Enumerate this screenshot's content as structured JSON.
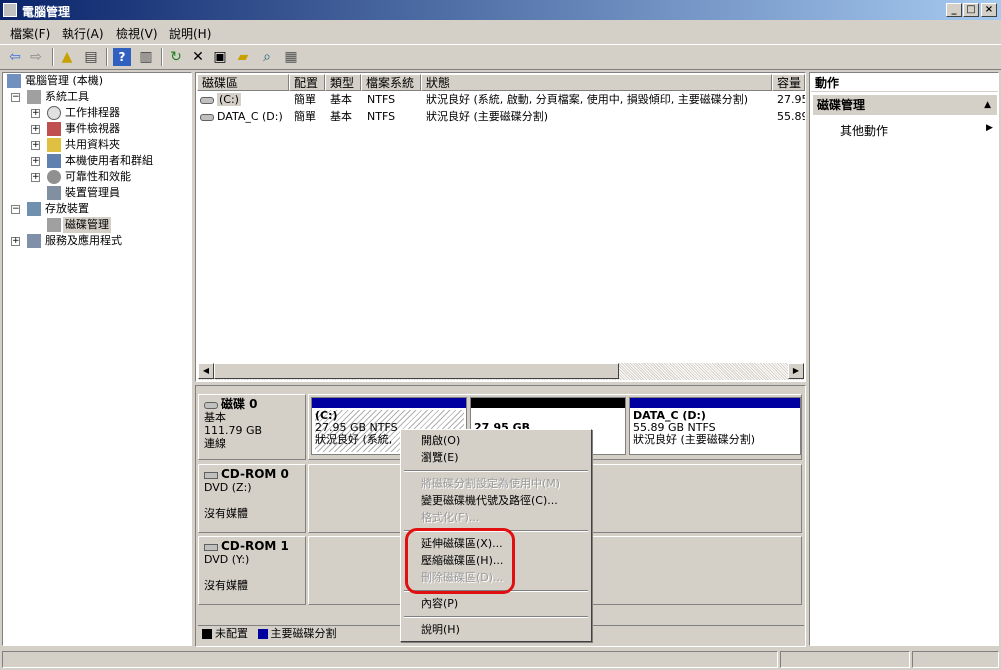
{
  "window": {
    "title": "電腦管理"
  },
  "menu": [
    "檔案(F)",
    "執行(A)",
    "檢視(V)",
    "說明(H)"
  ],
  "tree": {
    "root": "電腦管理 (本機)",
    "system_tools": "系統工具",
    "task_scheduler": "工作排程器",
    "event_viewer": "事件檢視器",
    "shared_folders": "共用資料夾",
    "local_users": "本機使用者和群組",
    "reliability": "可靠性和效能",
    "device_manager": "裝置管理員",
    "storage": "存放裝置",
    "disk_management": "磁碟管理",
    "services_apps": "服務及應用程式"
  },
  "volume_list": {
    "headers": [
      "磁碟區",
      "配置",
      "類型",
      "檔案系統",
      "狀態",
      "容量"
    ],
    "rows": [
      [
        "(C:)",
        "簡單",
        "基本",
        "NTFS",
        "狀況良好 (系統, 啟動, 分頁檔案, 使用中, 損毀傾印, 主要磁碟分割)",
        "27.95"
      ],
      [
        "DATA_C (D:)",
        "簡單",
        "基本",
        "NTFS",
        "狀況良好 (主要磁碟分割)",
        "55.89"
      ]
    ]
  },
  "disks": {
    "disk0": {
      "name": "磁碟 0",
      "type": "基本",
      "size": "111.79 GB",
      "state": "連線"
    },
    "cdrom0": {
      "name": "CD-ROM 0",
      "drive": "DVD (Z:)",
      "state": "沒有媒體"
    },
    "cdrom1": {
      "name": "CD-ROM 1",
      "drive": "DVD (Y:)",
      "state": "沒有媒體"
    },
    "partitions": {
      "c": {
        "name": "(C:)",
        "size": "27.95 GB NTFS",
        "status": "狀況良好 (系統,"
      },
      "mid": {
        "name": "27.95 GB"
      },
      "d": {
        "name": "DATA_C  (D:)",
        "size": "55.89 GB NTFS",
        "status": "狀況良好 (主要磁碟分割)"
      }
    }
  },
  "legend": {
    "unallocated": "未配置",
    "primary": "主要磁碟分割"
  },
  "actions": {
    "title": "動作",
    "section": "磁碟管理",
    "more": "其他動作"
  },
  "context_menu": {
    "open": "開啟(O)",
    "explore": "瀏覽(E)",
    "mark_active": "將磁碟分割設定為使用中(M)",
    "change_letter": "變更磁碟機代號及路徑(C)...",
    "format": "格式化(F)...",
    "extend": "延伸磁碟區(X)...",
    "shrink": "壓縮磁碟區(H)...",
    "delete": "刪除磁碟區(D)...",
    "properties": "內容(P)",
    "help": "說明(H)"
  },
  "colors": {
    "primary_partition": "#0000a0",
    "unallocated": "#000000",
    "highlight": "#e01010",
    "title_bar": "#0a246a"
  }
}
